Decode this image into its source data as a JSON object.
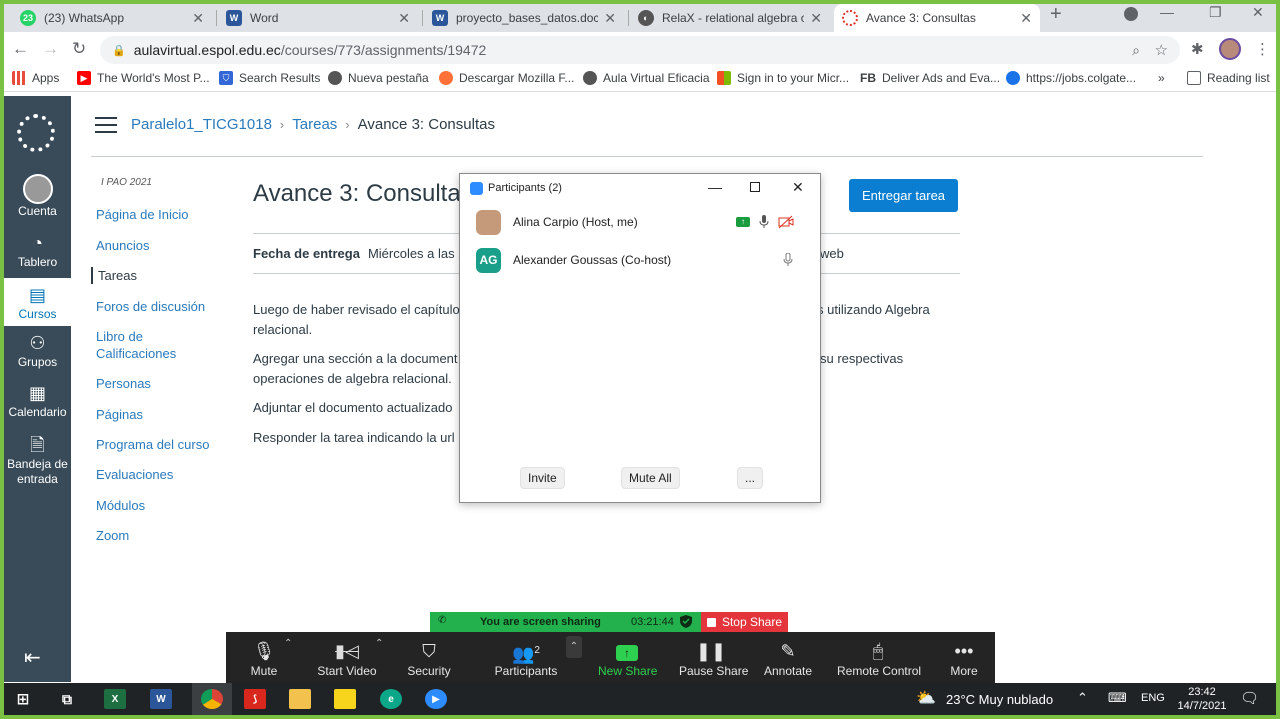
{
  "browser": {
    "tabs": [
      {
        "title": "(23) WhatsApp",
        "fav_text": "23",
        "fav_color": "#25d366"
      },
      {
        "title": "Word",
        "fav_text": "W",
        "fav_color": "#2b579a"
      },
      {
        "title": "proyecto_bases_datos.docx",
        "fav_text": "W",
        "fav_color": "#2b579a"
      },
      {
        "title": "RelaX - relational algebra calc",
        "fav_text": "◐",
        "fav_color": "#555555"
      },
      {
        "title": "Avance 3: Consultas",
        "fav_text": "",
        "fav_color": "#e0302a"
      }
    ],
    "url_host": "aulavirtual.espol.edu.ec",
    "url_path": "/courses/773/assignments/19472",
    "bookmarks": [
      {
        "label": "Apps",
        "color": "#e74c3c"
      },
      {
        "label": "The World's Most P...",
        "color": "#ff0000"
      },
      {
        "label": "Search Results",
        "color": "#3367d6"
      },
      {
        "label": "Nueva pestaña",
        "color": "#555555"
      },
      {
        "label": "Descargar Mozilla F...",
        "color": "#ff7139"
      },
      {
        "label": "Aula Virtual Eficacia",
        "color": "#555555"
      },
      {
        "label": "Sign in to your Micr...",
        "color": "#f25022"
      },
      {
        "label": "FB",
        "color": "#1877f2"
      },
      {
        "label": "Deliver Ads and Eva...",
        "color": "#1877f2"
      },
      {
        "label": "https://jobs.colgate...",
        "color": "#1a73e8"
      },
      {
        "label": "Reading list",
        "color": "#5f6368"
      }
    ],
    "bookmarks_more": "»"
  },
  "canvas_nav": {
    "items": [
      "Cuenta",
      "Tablero",
      "Cursos",
      "Grupos",
      "Calendario",
      "Bandeja de entrada"
    ]
  },
  "breadcrumb": {
    "course": "Paralelo1_TICG1018",
    "section": "Tareas",
    "current": "Avance 3: Consultas",
    "sep": "›"
  },
  "course_nav": {
    "term": "I PAO 2021",
    "items": [
      "Página de Inicio",
      "Anuncios",
      "Tareas",
      "Foros de discusión",
      "Libro de",
      "Calificaciones",
      "Personas",
      "Páginas",
      "Programa del curso",
      "Evaluaciones",
      "Módulos",
      "Zoom"
    ]
  },
  "assignment": {
    "title": "Avance 3: Consulta",
    "submit_label": "Entregar tarea",
    "due_label": "Fecha de entrega",
    "due_value": "Miércoles a las 2",
    "due_tail": "web",
    "paragraphs": [
      "Luego de haber revisado el capítulo",
      "s utilizando Algebra",
      "relacional.",
      "Agregar una sección a la document",
      "su respectivas",
      "operaciones de algebra relacional.",
      "Adjuntar el documento actualizado",
      "Responder la tarea indicando la url"
    ]
  },
  "participants": {
    "title": "Participants (2)",
    "rows": [
      {
        "name": "Alina Carpio (Host, me)",
        "initials": ""
      },
      {
        "name": "Alexander Goussas (Co-host)",
        "initials": "AG"
      }
    ],
    "invite": "Invite",
    "mute_all": "Mute All",
    "more": "..."
  },
  "share_banner": {
    "text": "You are screen sharing",
    "time": "03:21:44",
    "stop": "Stop Share"
  },
  "zoom_toolbar": {
    "mute": "Mute",
    "start_video": "Start Video",
    "security": "Security",
    "participants": "Participants",
    "participants_count": "2",
    "new_share": "New Share",
    "pause_share": "Pause Share",
    "annotate": "Annotate",
    "remote_control": "Remote Control",
    "more": "More"
  },
  "taskbar": {
    "weather": "23°C  Muy nublado",
    "lang": "ENG",
    "time": "23:42",
    "date": "14/7/2021"
  }
}
